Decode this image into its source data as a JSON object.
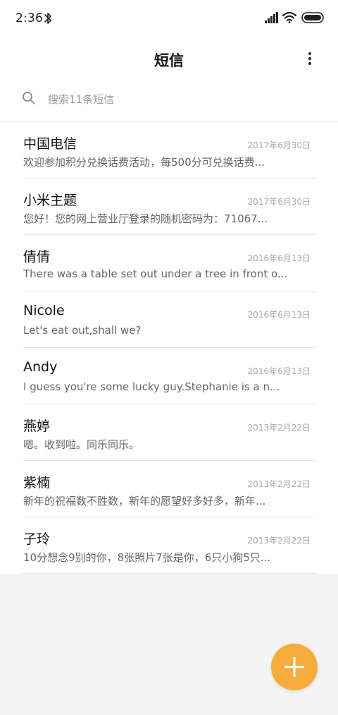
{
  "status_bar": {
    "time": "2:36",
    "icons": [
      "bluetooth-icon",
      "signal-icon",
      "wifi-icon",
      "battery-icon"
    ]
  },
  "header": {
    "title": "短信",
    "more_icon": "more-vertical-icon"
  },
  "search": {
    "placeholder": "搜索11条短信",
    "icon": "search-icon"
  },
  "conversations": [
    {
      "name": "中国电信",
      "date": "2017年6月30日",
      "preview": "欢迎参加积分兑换话费活动，每500分可兑换话费..."
    },
    {
      "name": "小米主题",
      "date": "2017年6月30日",
      "preview": "您好！您的网上营业厅登录的随机密码为：71067..."
    },
    {
      "name": "倩倩",
      "date": "2016年6月13日",
      "preview": "There was a table set out under a tree in front o..."
    },
    {
      "name": "Nicole",
      "date": "2016年6月13日",
      "preview": "Let's eat out,shall we?"
    },
    {
      "name": "Andy",
      "date": "2016年6月13日",
      "preview": "I guess you're some lucky guy.Stephanie is a n..."
    },
    {
      "name": "燕婷",
      "date": "2013年2月22日",
      "preview": "嗯。收到啦。同乐同乐。"
    },
    {
      "name": "紫楠",
      "date": "2013年2月22日",
      "preview": "新年的祝福数不胜数，新年的愿望好多好多，新年..."
    },
    {
      "name": "子玲",
      "date": "2013年2月22日",
      "preview": "10分想念9别的你，8张照片7张是你，6只小狗5只..."
    }
  ],
  "fab": {
    "icon": "plus-icon",
    "color": "#f6ac3a"
  },
  "colors": {
    "background": "#f4f4f4",
    "list_background": "#ffffff",
    "accent": "#f6ac3a"
  }
}
